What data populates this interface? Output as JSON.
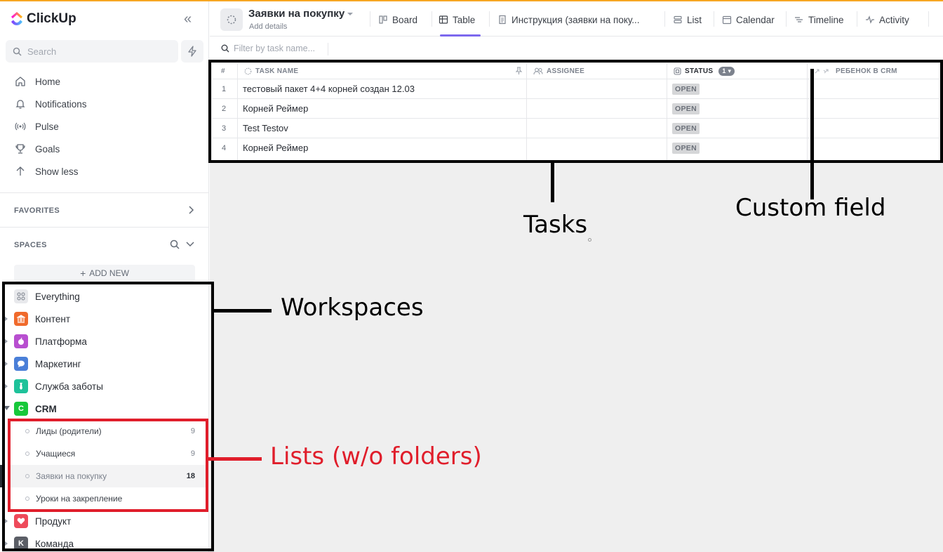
{
  "app": {
    "name": "ClickUp",
    "brand_color": "#f7a623"
  },
  "sidebar": {
    "search_placeholder": "Search",
    "nav": [
      {
        "label": "Home",
        "icon": "home-icon"
      },
      {
        "label": "Notifications",
        "icon": "bell-icon"
      },
      {
        "label": "Pulse",
        "icon": "pulse-icon"
      },
      {
        "label": "Goals",
        "icon": "trophy-icon"
      },
      {
        "label": "Show less",
        "icon": "arrow-up-icon"
      }
    ],
    "favorites_title": "FAVORITES",
    "spaces_title": "SPACES",
    "add_new": "ADD NEW",
    "spaces": [
      {
        "label": "Everything",
        "color": "#e8e9ec",
        "letter": ""
      },
      {
        "label": "Контент",
        "color": "#f06a2c",
        "letter": ""
      },
      {
        "label": "Платформа",
        "color": "#b84fd0",
        "letter": ""
      },
      {
        "label": "Маркетинг",
        "color": "#4a7fd8",
        "letter": ""
      },
      {
        "label": "Служба заботы",
        "color": "#1ec29a",
        "letter": ""
      },
      {
        "label": "CRM",
        "color": "#17c83a",
        "letter": "C"
      },
      {
        "label": "Продукт",
        "color": "#ee4a5a",
        "letter": ""
      },
      {
        "label": "Команда",
        "color": "#5b5e66",
        "letter": "K"
      }
    ],
    "lists": [
      {
        "label": "Лиды (родители)",
        "count": "9"
      },
      {
        "label": "Учащиеся",
        "count": "9"
      },
      {
        "label": "Заявки на покупку",
        "count": "18"
      },
      {
        "label": "Уроки на закрепление",
        "count": ""
      }
    ]
  },
  "header": {
    "list_title": "Заявки на покупку",
    "add_details": "Add details",
    "views": [
      {
        "label": "Board"
      },
      {
        "label": "Table"
      },
      {
        "label": "Инструкция (заявки на поку..."
      },
      {
        "label": "List"
      },
      {
        "label": "Calendar"
      },
      {
        "label": "Timeline"
      },
      {
        "label": "Activity"
      }
    ],
    "active_view_color": "#7c68ee"
  },
  "filter": {
    "placeholder": "Filter by task name..."
  },
  "table": {
    "columns": {
      "index": "#",
      "task_name": "TASK NAME",
      "assignee": "ASSIGNEE",
      "status": "STATUS",
      "status_count": "1",
      "custom": "РЕБЕНОК В CRM"
    },
    "rows": [
      {
        "index": "1",
        "name": "тестовый пакет 4+4 корней создан 12.03",
        "status": "OPEN"
      },
      {
        "index": "2",
        "name": "Корней Реймер",
        "status": "OPEN"
      },
      {
        "index": "3",
        "name": "Test Testov",
        "status": "OPEN"
      },
      {
        "index": "4",
        "name": "Корней Реймер",
        "status": "OPEN"
      }
    ]
  },
  "annotations": {
    "tasks": "Tasks",
    "custom_field": "Custom field",
    "workspaces": "Workspaces",
    "lists": "Lists (w/o folders)",
    "black": "#000000",
    "red": "#e01e2b"
  }
}
